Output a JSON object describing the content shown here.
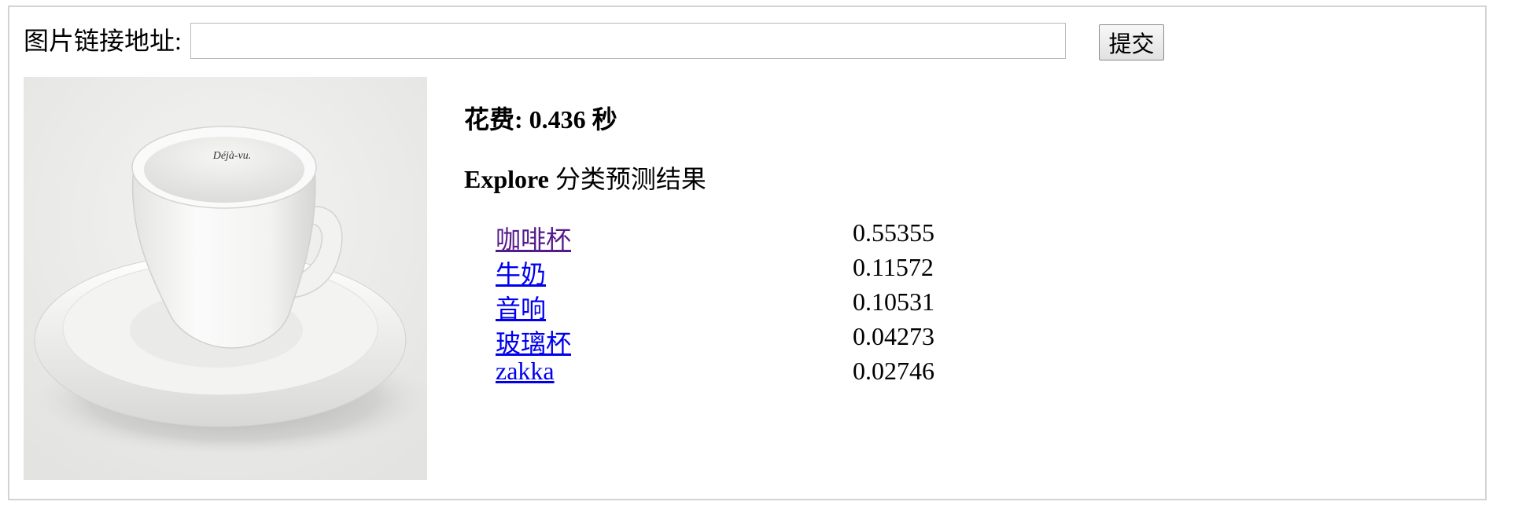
{
  "form": {
    "url_label": "图片链接地址:",
    "url_value": "",
    "submit_label": "提交"
  },
  "result": {
    "time_prefix": "花费: ",
    "time_value": "0.436",
    "time_unit": " 秒",
    "title_bold": "Explore",
    "title_rest": " 分类预测结果"
  },
  "photo": {
    "cup_inscription": "Déjà-vu."
  },
  "predictions": [
    {
      "label": "咖啡杯",
      "score": "0.55355",
      "visited": true
    },
    {
      "label": "牛奶",
      "score": "0.11572",
      "visited": false
    },
    {
      "label": "音响",
      "score": "0.10531",
      "visited": false
    },
    {
      "label": "玻璃杯",
      "score": "0.04273",
      "visited": false
    },
    {
      "label": "zakka",
      "score": "0.02746",
      "visited": false
    }
  ],
  "colors": {
    "link": "#0000ee",
    "link_visited": "#551a8b",
    "frame_border": "#d3d3d3"
  }
}
